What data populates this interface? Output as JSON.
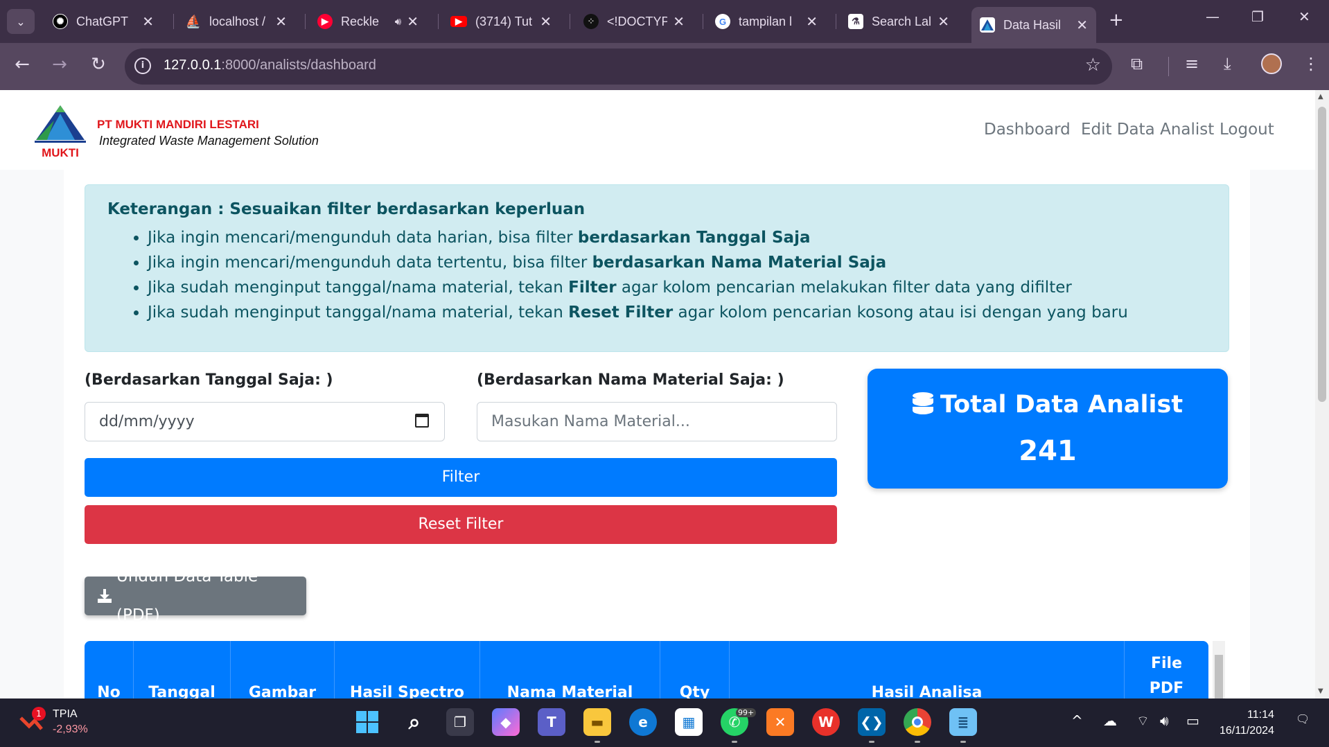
{
  "browser": {
    "tabs": [
      {
        "label": "ChatGPT",
        "icon": "chatgpt-icon",
        "color": "#ffffff"
      },
      {
        "label": "localhost /",
        "icon": "phpmyadmin-icon",
        "color": "#f29111"
      },
      {
        "label": "Reckle",
        "icon": "music-icon",
        "color": "#ff0033"
      },
      {
        "label": "(3714) Tut",
        "icon": "youtube-icon",
        "color": "#ff0000"
      },
      {
        "label": "<!DOCTYP",
        "icon": "dots-icon",
        "color": "#222222"
      },
      {
        "label": "tampilan l",
        "icon": "google-icon",
        "color": "#ffffff"
      },
      {
        "label": "Search Lal",
        "icon": "flask-icon",
        "color": "#ffffff"
      },
      {
        "label": "Data Hasil",
        "icon": "mukti-icon",
        "color": "#ffffff",
        "active": true
      }
    ],
    "url_host": "127.0.0.1",
    "url_path": ":8000/analists/dashboard"
  },
  "header": {
    "company": "PT MUKTI MANDIRI LESTARI",
    "tagline": "Integrated Waste Management Solution",
    "logo_text": "MUKTI",
    "nav": [
      "Dashboard",
      "Edit Data Analist",
      "Logout"
    ]
  },
  "info": {
    "title": "Keterangan : Sesuaikan filter berdasarkan keperluan",
    "items": [
      {
        "prefix": "Jika ingin mencari/mengunduh data harian, bisa filter ",
        "bold": "berdasarkan Tanggal Saja",
        "suffix": ""
      },
      {
        "prefix": "Jika ingin mencari/mengunduh data tertentu, bisa filter ",
        "bold": "berdasarkan Nama Material Saja",
        "suffix": ""
      },
      {
        "prefix": "Jika sudah menginput tanggal/nama material, tekan ",
        "bold": "Filter",
        "suffix": " agar kolom pencarian melakukan filter data yang difilter"
      },
      {
        "prefix": "Jika sudah menginput tanggal/nama material, tekan ",
        "bold": "Reset Filter",
        "suffix": " agar kolom pencarian kosong atau isi dengan yang baru"
      }
    ]
  },
  "filters": {
    "date_label": "(Berdasarkan Tanggal Saja: )",
    "date_placeholder": "dd/mm/yyyy",
    "material_label": "(Berdasarkan Nama Material Saja: )",
    "material_placeholder": "Masukan Nama Material...",
    "filter_button": "Filter",
    "reset_button": "Reset Filter"
  },
  "total": {
    "title": "Total Data Analist",
    "value": "241"
  },
  "download_button": "Unduh Data Table (PDF)",
  "table": {
    "columns": [
      "No",
      "Tanggal",
      "Gambar",
      "Hasil Spectro",
      "Nama Material",
      "Qty",
      "Hasil Analisa",
      "File PDF"
    ]
  },
  "taskbar": {
    "stock_name": "TPIA",
    "stock_change": "-2,93%",
    "stock_badge": "1",
    "time": "11:14",
    "date": "16/11/2024",
    "whatsapp_badge": "99+"
  },
  "colors": {
    "primary": "#007bff",
    "danger": "#dc3545",
    "secondary": "#6c757d",
    "alert_bg": "#d1ecf1",
    "alert_text": "#0c5460",
    "brand_red": "#e0161b"
  }
}
